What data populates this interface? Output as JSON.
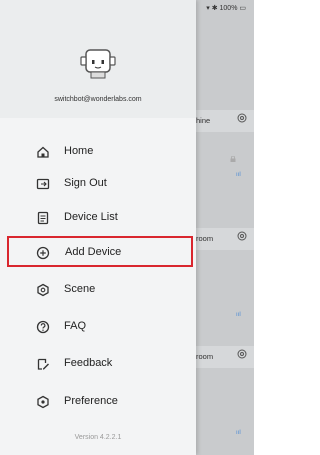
{
  "status_bar": {
    "text": "100%"
  },
  "background": {
    "device_cards": [
      {
        "label": "hine"
      },
      {
        "label": "room"
      },
      {
        "label": "room"
      }
    ]
  },
  "drawer": {
    "email": "switchbot@wonderlabs.com",
    "menu": [
      {
        "label": "Home",
        "icon": "home-icon"
      },
      {
        "label": "Sign Out",
        "icon": "sign-out-icon"
      },
      {
        "label": "Device List",
        "icon": "device-list-icon"
      },
      {
        "label": "Add Device",
        "icon": "add-circle-icon",
        "highlighted": true
      },
      {
        "label": "Scene",
        "icon": "scene-icon"
      },
      {
        "label": "FAQ",
        "icon": "faq-icon"
      },
      {
        "label": "Feedback",
        "icon": "feedback-icon"
      },
      {
        "label": "Preference",
        "icon": "preference-icon"
      }
    ],
    "version": "Version 4.2.2.1"
  },
  "colors": {
    "highlight_border": "#d9262e"
  }
}
